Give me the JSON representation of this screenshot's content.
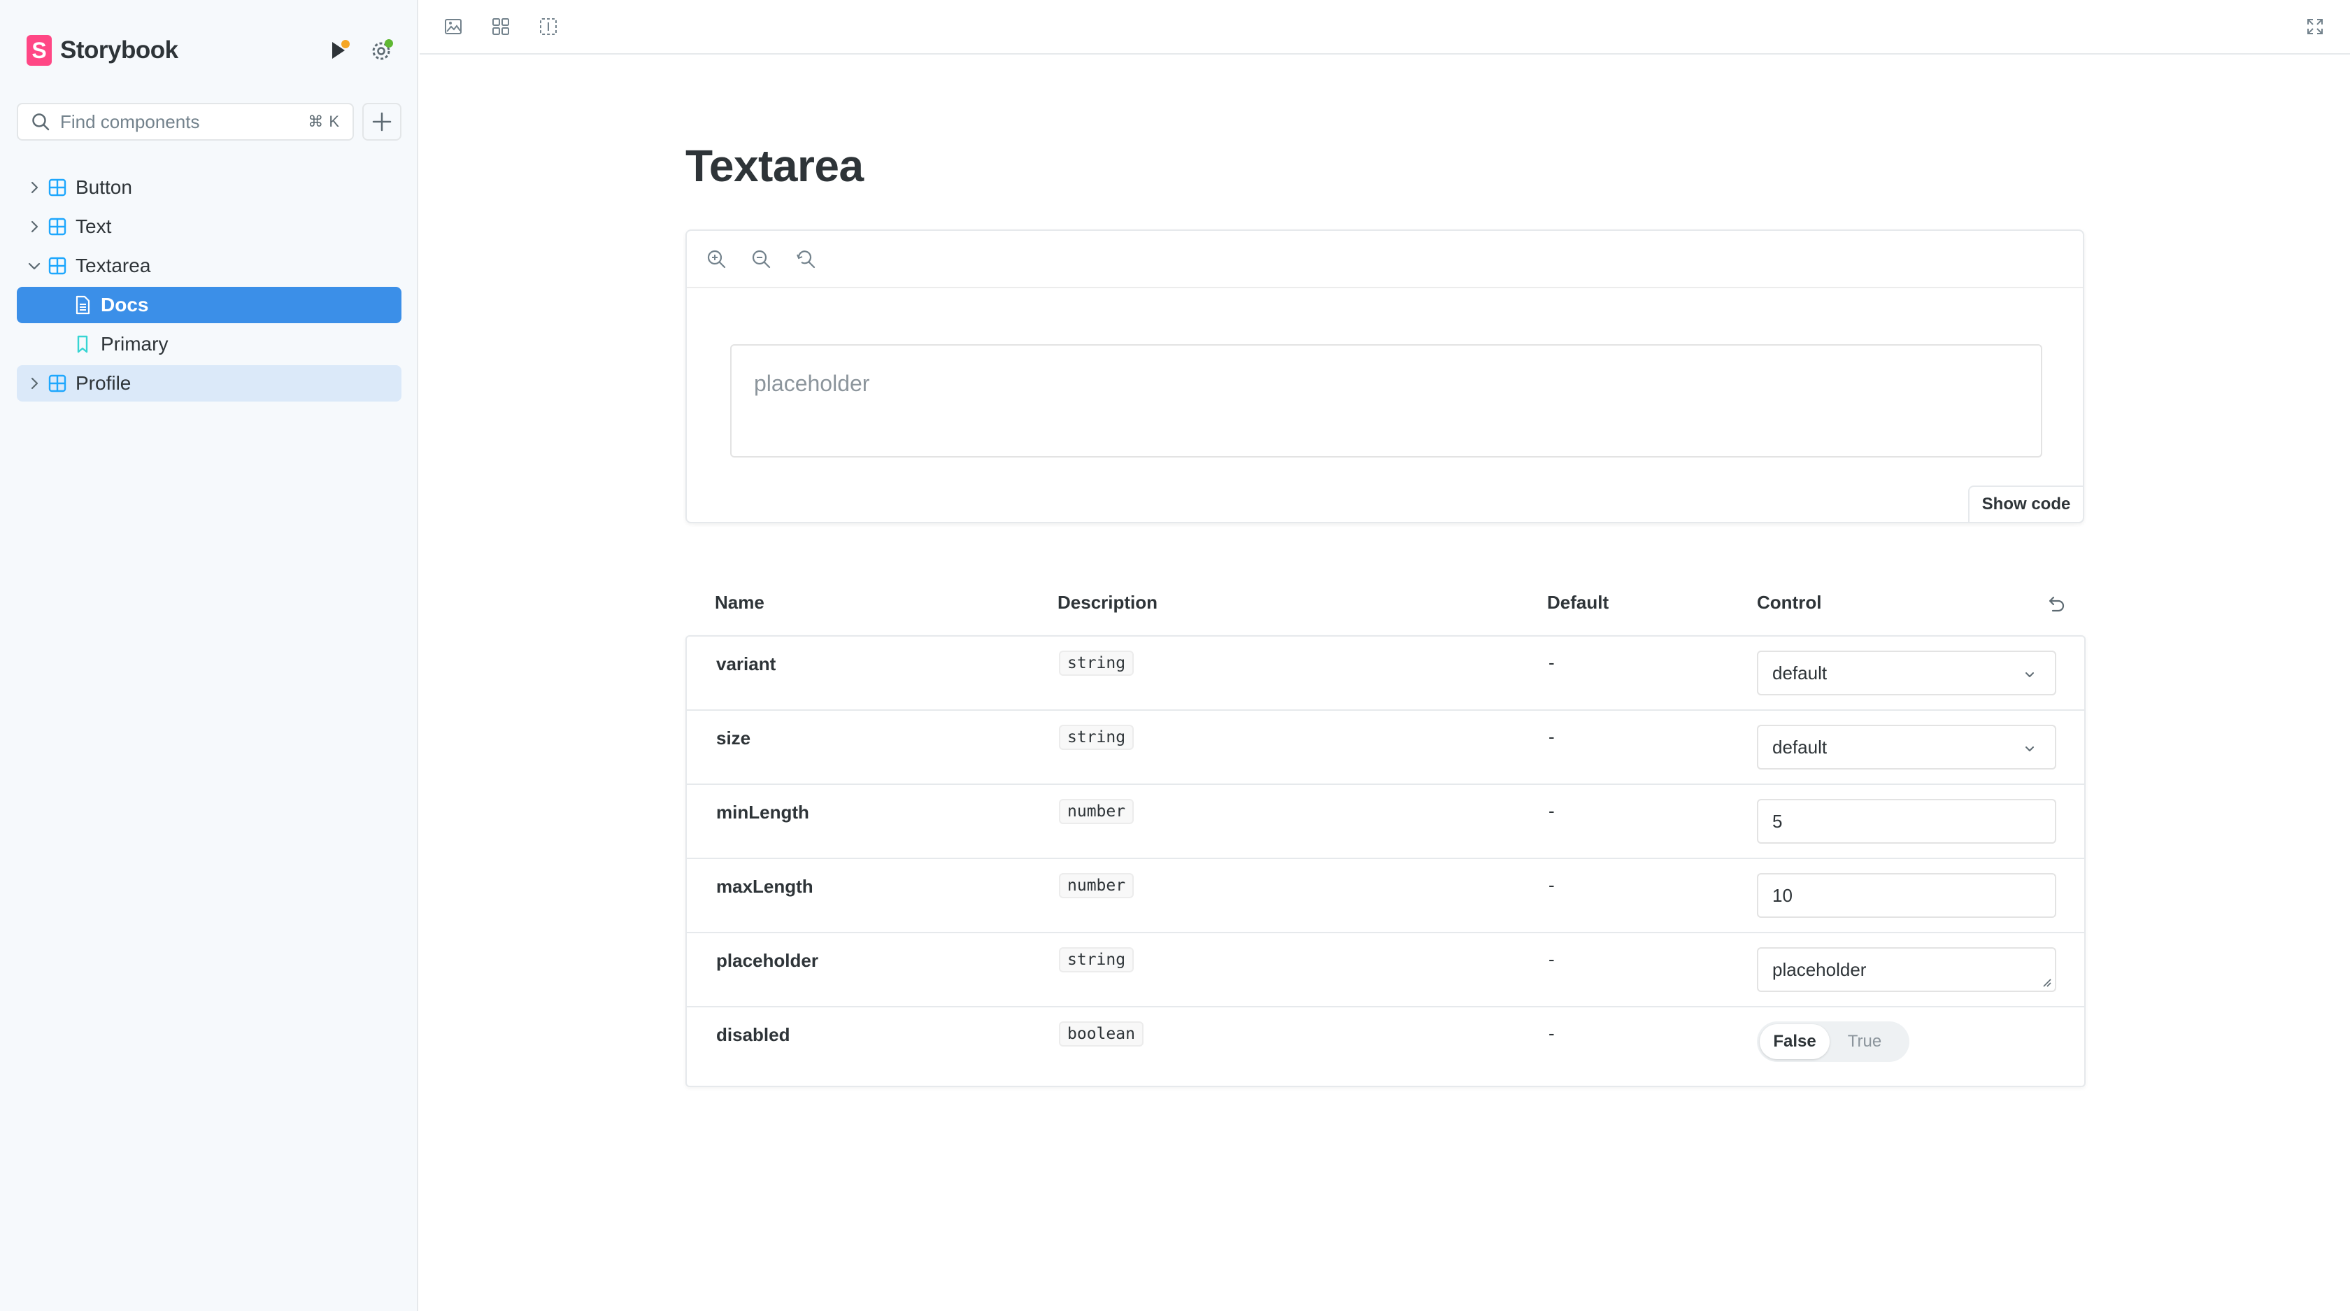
{
  "app": {
    "name": "Storybook",
    "logo_letter": "S"
  },
  "search": {
    "placeholder": "Find components",
    "shortcut": "⌘ K"
  },
  "sidebar": {
    "items": [
      {
        "label": "Button",
        "kind": "component",
        "expanded": false
      },
      {
        "label": "Text",
        "kind": "component",
        "expanded": false
      },
      {
        "label": "Textarea",
        "kind": "component",
        "expanded": true
      },
      {
        "label": "Docs",
        "kind": "docs",
        "selected": true
      },
      {
        "label": "Primary",
        "kind": "story"
      },
      {
        "label": "Profile",
        "kind": "component",
        "expanded": false,
        "hovered": true
      }
    ]
  },
  "docs": {
    "title": "Textarea",
    "preview": {
      "textarea_placeholder": "placeholder",
      "show_code_label": "Show code"
    },
    "args_table": {
      "headers": {
        "name": "Name",
        "description": "Description",
        "default": "Default",
        "control": "Control"
      },
      "rows": [
        {
          "name": "variant",
          "type": "string",
          "default": "-",
          "control": "select",
          "value": "default"
        },
        {
          "name": "size",
          "type": "string",
          "default": "-",
          "control": "select",
          "value": "default"
        },
        {
          "name": "minLength",
          "type": "number",
          "default": "-",
          "control": "number",
          "value": "5"
        },
        {
          "name": "maxLength",
          "type": "number",
          "default": "-",
          "control": "number",
          "value": "10"
        },
        {
          "name": "placeholder",
          "type": "string",
          "default": "-",
          "control": "text",
          "value": "placeholder"
        },
        {
          "name": "disabled",
          "type": "boolean",
          "default": "-",
          "control": "boolean",
          "false_label": "False",
          "true_label": "True",
          "value": false
        }
      ]
    }
  },
  "colors": {
    "accent": "#3b8fe8",
    "brand": "#ff4785",
    "selected_bg": "#3b8fe8",
    "hover_bg": "#dbe9f9",
    "status_dot_orange": "#f5a623",
    "status_dot_green": "#5fb832"
  }
}
